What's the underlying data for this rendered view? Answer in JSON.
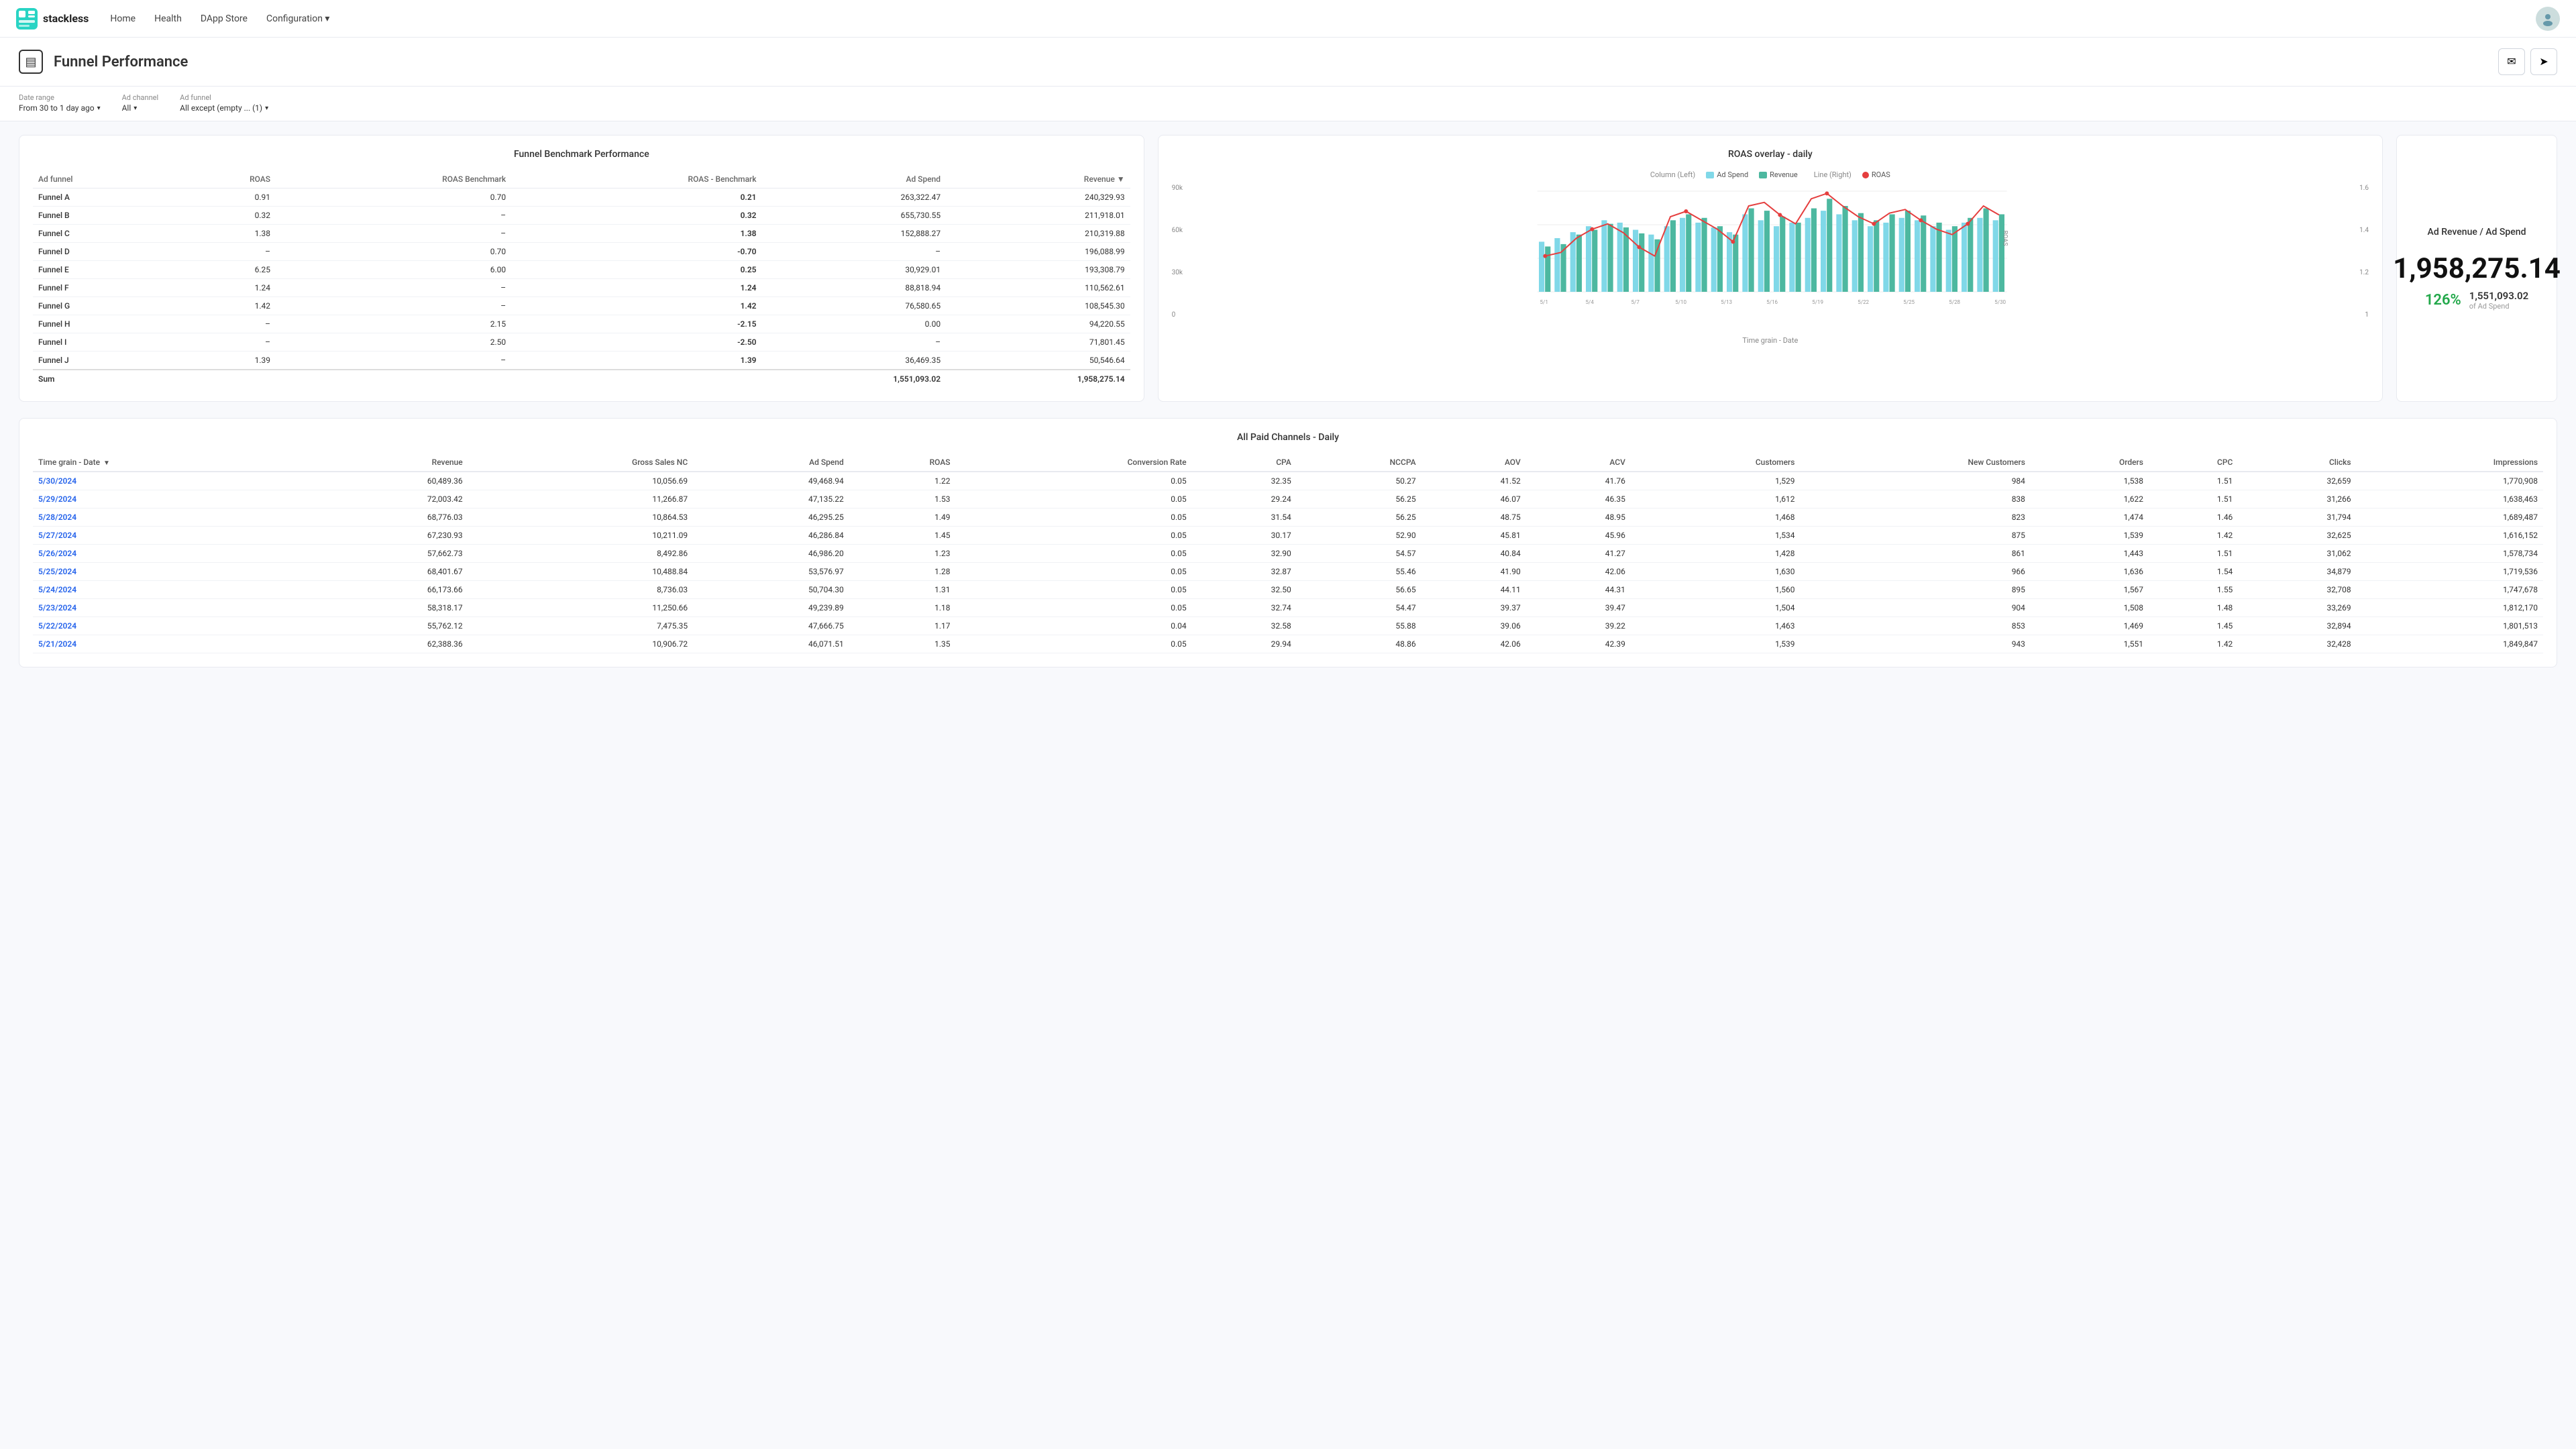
{
  "navbar": {
    "brand": "stackless",
    "links": [
      "Home",
      "Health",
      "DApp Store",
      "Configuration"
    ]
  },
  "header": {
    "title": "Funnel Performance",
    "icon": "▤",
    "btn_email": "✉",
    "btn_send": "➤"
  },
  "filters": {
    "date_range_label": "Date range",
    "date_range_value": "From 30 to 1 day ago",
    "ad_channel_label": "Ad channel",
    "ad_channel_value": "All",
    "ad_funnel_label": "Ad funnel",
    "ad_funnel_value": "All except (empty ... (1)"
  },
  "funnel_table": {
    "title": "Funnel Benchmark Performance",
    "columns": [
      "Ad funnel",
      "ROAS",
      "ROAS Benchmark",
      "ROAS - Benchmark",
      "Ad Spend",
      "Revenue"
    ],
    "rows": [
      {
        "name": "Funnel A",
        "roas": "0.91",
        "benchmark": "0.70",
        "diff": "0.21",
        "diff_type": "positive",
        "ad_spend": "263,322.47",
        "revenue": "240,329.93"
      },
      {
        "name": "Funnel B",
        "roas": "0.32",
        "benchmark": "–",
        "diff": "0.32",
        "diff_type": "positive",
        "ad_spend": "655,730.55",
        "revenue": "211,918.01"
      },
      {
        "name": "Funnel C",
        "roas": "1.38",
        "benchmark": "–",
        "diff": "1.38",
        "diff_type": "positive",
        "ad_spend": "152,888.27",
        "revenue": "210,319.88"
      },
      {
        "name": "Funnel D",
        "roas": "–",
        "benchmark": "0.70",
        "diff": "-0.70",
        "diff_type": "negative",
        "ad_spend": "–",
        "revenue": "196,088.99"
      },
      {
        "name": "Funnel E",
        "roas": "6.25",
        "benchmark": "6.00",
        "diff": "0.25",
        "diff_type": "positive",
        "ad_spend": "30,929.01",
        "revenue": "193,308.79"
      },
      {
        "name": "Funnel F",
        "roas": "1.24",
        "benchmark": "–",
        "diff": "1.24",
        "diff_type": "positive",
        "ad_spend": "88,818.94",
        "revenue": "110,562.61"
      },
      {
        "name": "Funnel G",
        "roas": "1.42",
        "benchmark": "–",
        "diff": "1.42",
        "diff_type": "positive",
        "ad_spend": "76,580.65",
        "revenue": "108,545.30"
      },
      {
        "name": "Funnel H",
        "roas": "–",
        "benchmark": "2.15",
        "diff": "-2.15",
        "diff_type": "negative",
        "ad_spend": "0.00",
        "revenue": "94,220.55"
      },
      {
        "name": "Funnel I",
        "roas": "–",
        "benchmark": "2.50",
        "diff": "-2.50",
        "diff_type": "negative",
        "ad_spend": "–",
        "revenue": "71,801.45"
      },
      {
        "name": "Funnel J",
        "roas": "1.39",
        "benchmark": "–",
        "diff": "1.39",
        "diff_type": "positive",
        "ad_spend": "36,469.35",
        "revenue": "50,546.64"
      }
    ],
    "sum": {
      "label": "Sum",
      "ad_spend": "1,551,093.02",
      "revenue": "1,958,275.14"
    }
  },
  "chart": {
    "title": "ROAS overlay - daily",
    "legend": {
      "col_label": "Column (Left)",
      "ad_spend_label": "Ad Spend",
      "revenue_label": "Revenue",
      "line_label": "Line (Right)",
      "roas_label": "ROAS"
    },
    "y_labels": [
      "90k",
      "60k",
      "30k",
      "0"
    ],
    "roas_y_labels": [
      "1.6",
      "1.4",
      "1.2",
      "1"
    ],
    "x_label": "Time grain - Date",
    "colors": {
      "ad_spend": "#80d8e8",
      "revenue": "#4db8a0",
      "roas_line": "#e53e3e"
    }
  },
  "kpi": {
    "title": "Ad Revenue / Ad Spend",
    "big_number": "1,958,275.14",
    "pct": "126%",
    "detail_number": "1,551,093.02",
    "of_label": "of",
    "detail_label": "Ad Spend"
  },
  "daily_table": {
    "title": "All Paid Channels - Daily",
    "columns": [
      "Time grain - Date",
      "Revenue",
      "Gross Sales NC",
      "Ad Spend",
      "ROAS",
      "Conversion Rate",
      "CPA",
      "NCCPA",
      "AOV",
      "ACV",
      "Customers",
      "New Customers",
      "Orders",
      "CPC",
      "Clicks",
      "Impressions"
    ],
    "rows": [
      {
        "date": "5/30/2024",
        "revenue": "60,489.36",
        "gross_sales_nc": "10,056.69",
        "ad_spend": "49,468.94",
        "roas": "1.22",
        "conv_rate": "0.05",
        "cpa": "32.35",
        "nccpa": "50.27",
        "aov": "41.52",
        "acv": "41.76",
        "customers": "1,529",
        "new_customers": "984",
        "orders": "1,538",
        "cpc": "1.51",
        "clicks": "32,659",
        "impressions": "1,770,908"
      },
      {
        "date": "5/29/2024",
        "revenue": "72,003.42",
        "gross_sales_nc": "11,266.87",
        "ad_spend": "47,135.22",
        "roas": "1.53",
        "conv_rate": "0.05",
        "cpa": "29.24",
        "nccpa": "56.25",
        "aov": "46.07",
        "acv": "46.35",
        "customers": "1,612",
        "new_customers": "838",
        "orders": "1,622",
        "cpc": "1.51",
        "clicks": "31,266",
        "impressions": "1,638,463"
      },
      {
        "date": "5/28/2024",
        "revenue": "68,776.03",
        "gross_sales_nc": "10,864.53",
        "ad_spend": "46,295.25",
        "roas": "1.49",
        "conv_rate": "0.05",
        "cpa": "31.54",
        "nccpa": "56.25",
        "aov": "48.75",
        "acv": "48.95",
        "customers": "1,468",
        "new_customers": "823",
        "orders": "1,474",
        "cpc": "1.46",
        "clicks": "31,794",
        "impressions": "1,689,487"
      },
      {
        "date": "5/27/2024",
        "revenue": "67,230.93",
        "gross_sales_nc": "10,211.09",
        "ad_spend": "46,286.84",
        "roas": "1.45",
        "conv_rate": "0.05",
        "cpa": "30.17",
        "nccpa": "52.90",
        "aov": "45.81",
        "acv": "45.96",
        "customers": "1,534",
        "new_customers": "875",
        "orders": "1,539",
        "cpc": "1.42",
        "clicks": "32,625",
        "impressions": "1,616,152"
      },
      {
        "date": "5/26/2024",
        "revenue": "57,662.73",
        "gross_sales_nc": "8,492.86",
        "ad_spend": "46,986.20",
        "roas": "1.23",
        "conv_rate": "0.05",
        "cpa": "32.90",
        "nccpa": "54.57",
        "aov": "40.84",
        "acv": "41.27",
        "customers": "1,428",
        "new_customers": "861",
        "orders": "1,443",
        "cpc": "1.51",
        "clicks": "31,062",
        "impressions": "1,578,734"
      },
      {
        "date": "5/25/2024",
        "revenue": "68,401.67",
        "gross_sales_nc": "10,488.84",
        "ad_spend": "53,576.97",
        "roas": "1.28",
        "conv_rate": "0.05",
        "cpa": "32.87",
        "nccpa": "55.46",
        "aov": "41.90",
        "acv": "42.06",
        "customers": "1,630",
        "new_customers": "966",
        "orders": "1,636",
        "cpc": "1.54",
        "clicks": "34,879",
        "impressions": "1,719,536"
      },
      {
        "date": "5/24/2024",
        "revenue": "66,173.66",
        "gross_sales_nc": "8,736.03",
        "ad_spend": "50,704.30",
        "roas": "1.31",
        "conv_rate": "0.05",
        "cpa": "32.50",
        "nccpa": "56.65",
        "aov": "44.11",
        "acv": "44.31",
        "customers": "1,560",
        "new_customers": "895",
        "orders": "1,567",
        "cpc": "1.55",
        "clicks": "32,708",
        "impressions": "1,747,678"
      },
      {
        "date": "5/23/2024",
        "revenue": "58,318.17",
        "gross_sales_nc": "11,250.66",
        "ad_spend": "49,239.89",
        "roas": "1.18",
        "conv_rate": "0.05",
        "cpa": "32.74",
        "nccpa": "54.47",
        "aov": "39.37",
        "acv": "39.47",
        "customers": "1,504",
        "new_customers": "904",
        "orders": "1,508",
        "cpc": "1.48",
        "clicks": "33,269",
        "impressions": "1,812,170"
      },
      {
        "date": "5/22/2024",
        "revenue": "55,762.12",
        "gross_sales_nc": "7,475.35",
        "ad_spend": "47,666.75",
        "roas": "1.17",
        "conv_rate": "0.04",
        "cpa": "32.58",
        "nccpa": "55.88",
        "aov": "39.06",
        "acv": "39.22",
        "customers": "1,463",
        "new_customers": "853",
        "orders": "1,469",
        "cpc": "1.45",
        "clicks": "32,894",
        "impressions": "1,801,513"
      },
      {
        "date": "5/21/2024",
        "revenue": "62,388.36",
        "gross_sales_nc": "10,906.72",
        "ad_spend": "46,071.51",
        "roas": "1.35",
        "conv_rate": "0.05",
        "cpa": "29.94",
        "nccpa": "48.86",
        "aov": "42.06",
        "acv": "42.39",
        "customers": "1,539",
        "new_customers": "943",
        "orders": "1,551",
        "cpc": "1.42",
        "clicks": "32,428",
        "impressions": "1,849,847"
      }
    ]
  }
}
